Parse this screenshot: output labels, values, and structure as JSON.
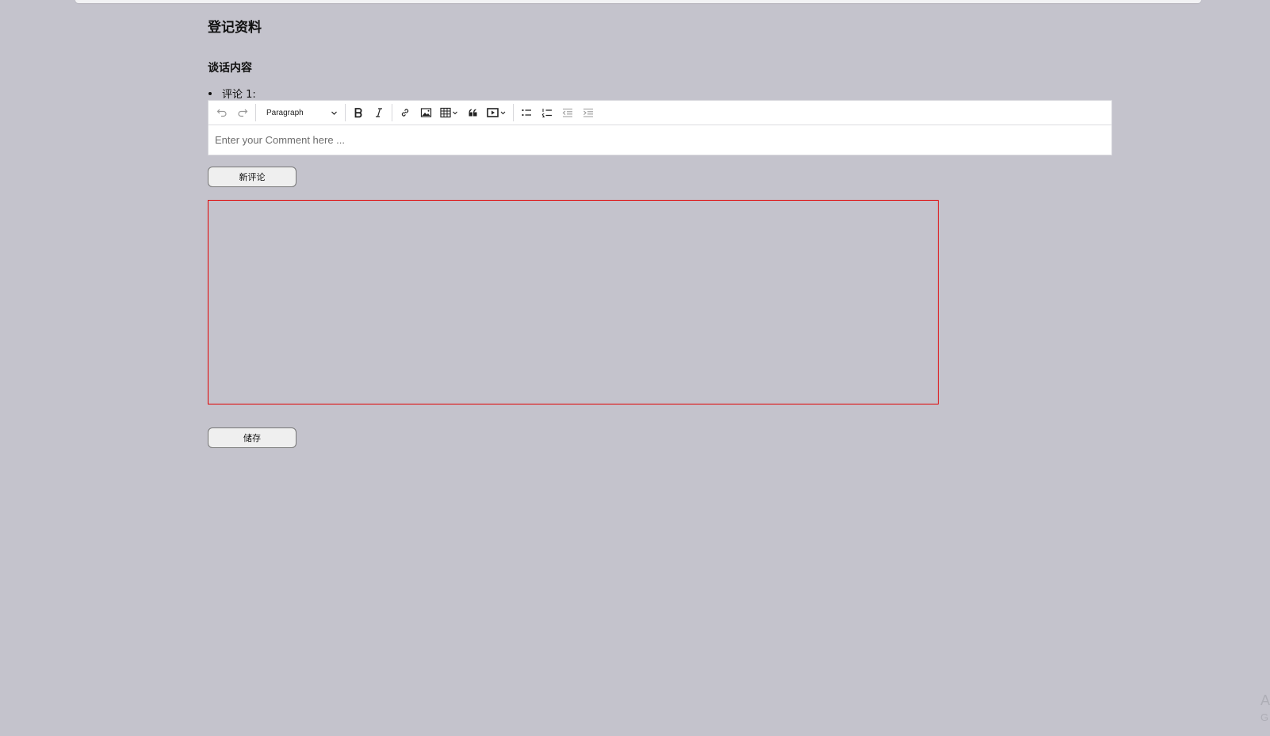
{
  "page": {
    "title": "登记资料",
    "section_title": "谈话内容",
    "comment_label": "评论 1:"
  },
  "editor": {
    "placeholder": "Enter your Comment here ...",
    "format_select": "Paragraph",
    "toolbar_icons": [
      "undo-icon",
      "redo-icon",
      "bold-icon",
      "italic-icon",
      "link-icon",
      "image-icon",
      "table-icon",
      "blockquote-icon",
      "media-icon",
      "bulleted-list-icon",
      "numbered-list-icon",
      "outdent-icon",
      "indent-icon"
    ]
  },
  "buttons": {
    "new_comment": "新评论",
    "save": "储存"
  },
  "watermark": {
    "line1": "A",
    "line2": "G"
  },
  "colors": {
    "background": "#c4c3cc",
    "highlight_border": "#e00000",
    "editor_bg": "#ffffff"
  }
}
